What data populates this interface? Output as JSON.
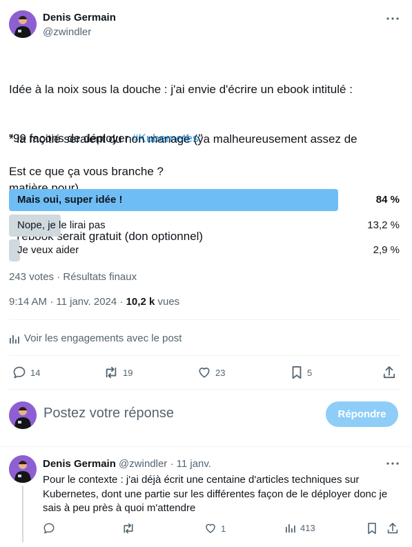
{
  "author": {
    "name": "Denis Germain",
    "handle": "@zwindler"
  },
  "tweet": {
    "line1": "Idée à la noix sous la douche : j'ai envie d'écrire un ebook intitulé :",
    "line2_prefix": "\"99 façons de déployer ",
    "line2_hashtag": "#Kubernetes",
    "line2_suffix": "\"",
    "bullet1_line1": "* la moitié seraient du non managé (ya malheureusement assez de",
    "bullet1_line2": "matière pour)",
    "bullet2": "* l'ebook serait gratuit (don optionnel)",
    "question": "Est ce que ça vous branche ?"
  },
  "poll": {
    "options": [
      {
        "label": "Mais oui, super idée !",
        "percent_text": "84 %",
        "percent": 84,
        "winner": true
      },
      {
        "label": "Nope, je le lirai pas",
        "percent_text": "13,2 %",
        "percent": 13.2,
        "winner": false
      },
      {
        "label": "Je veux aider",
        "percent_text": "2,9 %",
        "percent": 2.9,
        "winner": false
      }
    ],
    "votes": "243 votes",
    "separator": "·",
    "status": "Résultats finaux"
  },
  "timestamp": {
    "time": "9:14 AM",
    "separator": "·",
    "date": "11 janv. 2024",
    "views_count": "10,2 k",
    "views_label": "vues"
  },
  "engagements_link": "Voir les engagements avec le post",
  "actions": {
    "replies": "14",
    "reposts": "19",
    "likes": "23",
    "bookmarks": "5"
  },
  "compose": {
    "placeholder": "Postez votre réponse",
    "button": "Répondre"
  },
  "reply": {
    "name": "Denis Germain",
    "handle": "@zwindler",
    "separator": "·",
    "date": "11 janv.",
    "line1": "Pour le contexte : j'ai déjà écrit une centaine d'articles techniques sur",
    "line2": "Kubernetes, dont une partie sur les différentes façon de le déployer donc je",
    "line3": "sais à peu près à quoi m'attendre",
    "likes": "1",
    "views": "413"
  },
  "colors": {
    "accent": "#1d9bf0",
    "poll_winner": "#6fbdf5",
    "poll_other": "#cfd9de",
    "avatar_bg": "#8e5fd3",
    "button_disabled": "#8ecdf8"
  }
}
